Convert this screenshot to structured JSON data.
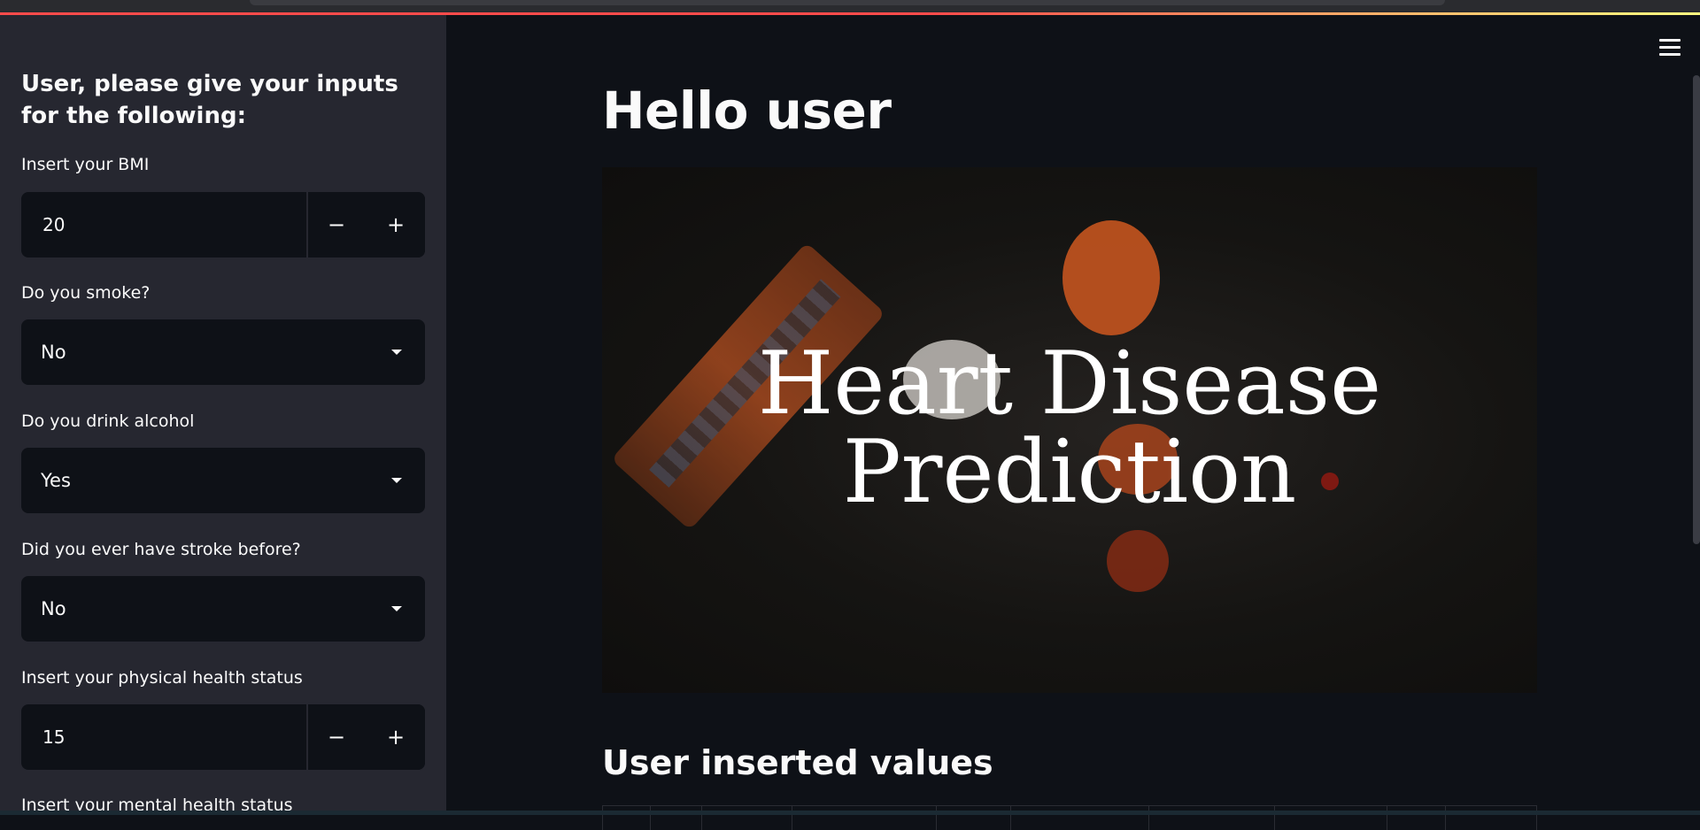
{
  "sidebar": {
    "title": "User, please give your inputs for the following:",
    "bmi": {
      "label": "Insert your BMI",
      "value": "20",
      "minus": "−",
      "plus": "+"
    },
    "smoke": {
      "label": "Do you smoke?",
      "value": "No"
    },
    "alcohol": {
      "label": "Do you drink alcohol",
      "value": "Yes"
    },
    "stroke": {
      "label": "Did you ever have stroke before?",
      "value": "No"
    },
    "physical": {
      "label": "Insert your physical health status",
      "value": "15",
      "minus": "−",
      "plus": "+"
    },
    "mental": {
      "label": "Insert your mental health status"
    }
  },
  "main": {
    "title": "Hello user",
    "hero": {
      "line1": "Heart Disease",
      "line2": "Prediction"
    },
    "section_title": "User inserted values",
    "menu_icon": "hamburger-menu-icon"
  },
  "colors": {
    "sidebar_bg": "#262730",
    "main_bg": "#0e1117",
    "accent": "#ff4b4b"
  }
}
